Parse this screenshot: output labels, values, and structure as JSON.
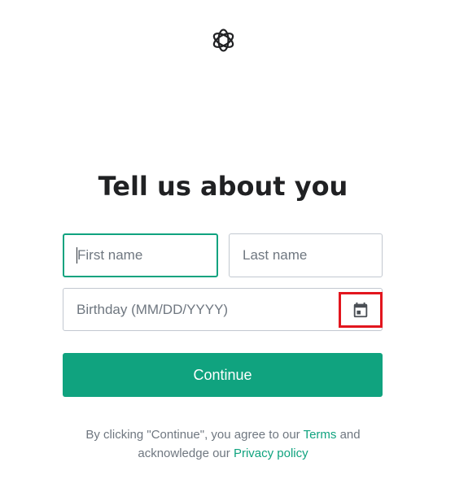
{
  "icons": {
    "logo": "openai-logo-icon",
    "calendar": "calendar-icon"
  },
  "colors": {
    "accent": "#10a37f",
    "highlight": "#e2161e"
  },
  "title": "Tell us about you",
  "form": {
    "first_name": {
      "placeholder": "First name",
      "value": ""
    },
    "last_name": {
      "placeholder": "Last name",
      "value": ""
    },
    "birthday": {
      "placeholder": "Birthday (MM/DD/YYYY)",
      "value": ""
    },
    "continue_label": "Continue"
  },
  "legal": {
    "text_1": "By clicking \"Continue\", you agree to our ",
    "terms_link": "Terms",
    "text_2": " and acknowledge our ",
    "privacy_link": "Privacy policy"
  }
}
